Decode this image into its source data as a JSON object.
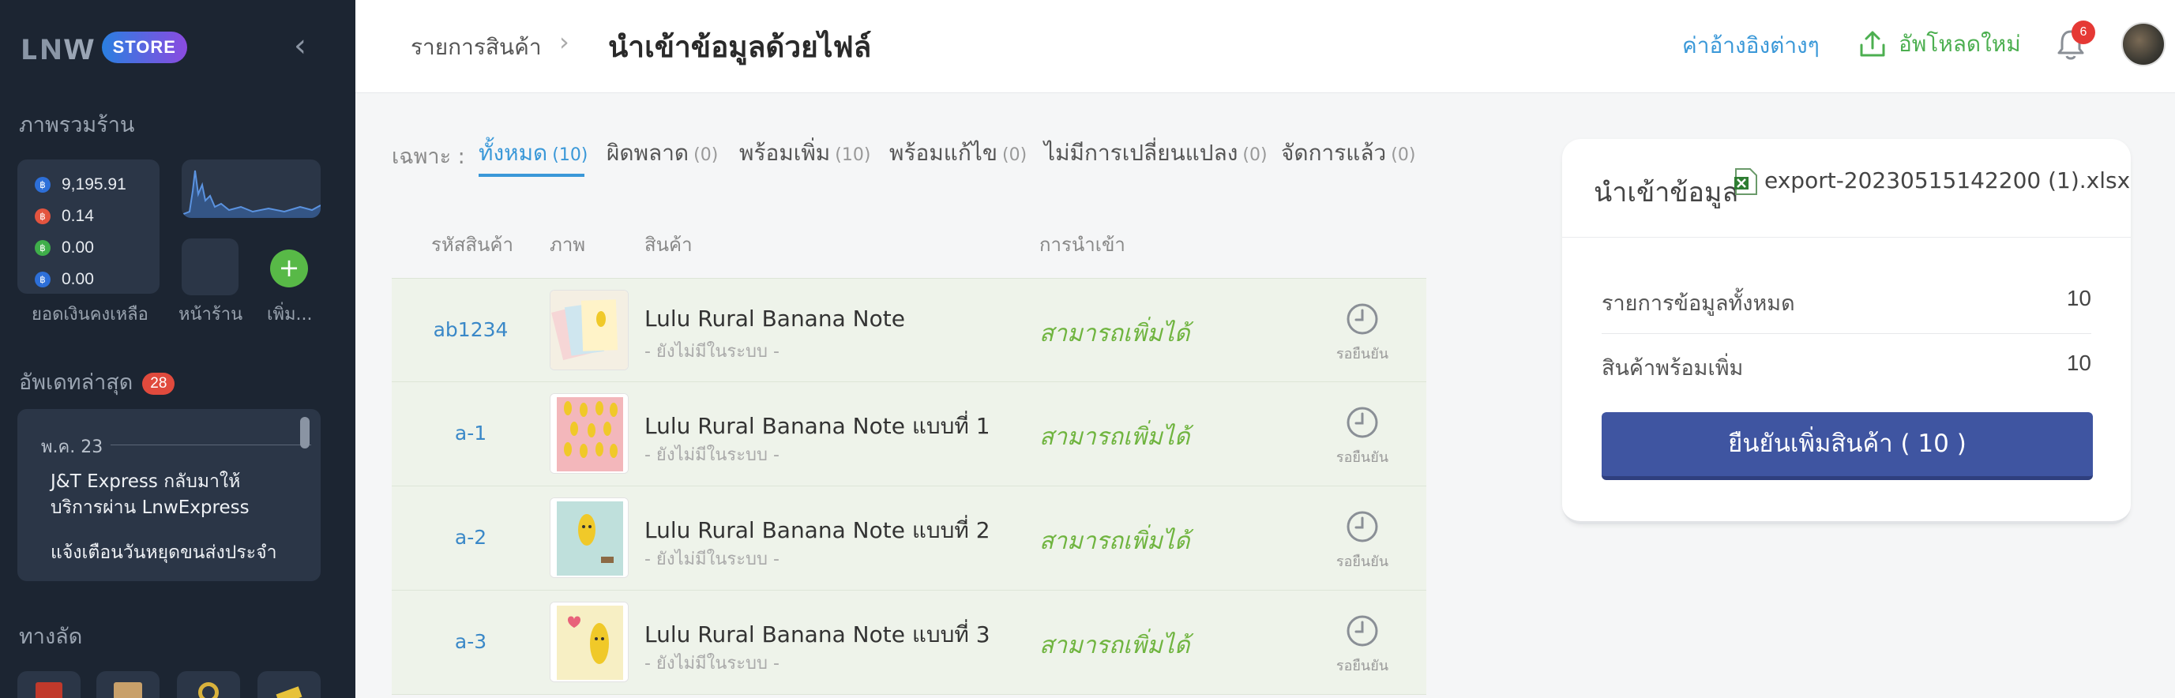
{
  "sidebar": {
    "logo_text": "LNW",
    "logo_badge": "STORE",
    "overview_heading": "ภาพรวมร้าน",
    "balances": [
      {
        "value": "9,195.91",
        "color": "#2d6fd8"
      },
      {
        "value": "0.14",
        "color": "#e3543f"
      },
      {
        "value": "0.00",
        "color": "#3fae4a"
      },
      {
        "value": "0.00",
        "color": "#2d6fd8"
      }
    ],
    "coin_symbol": "฿",
    "balance_caption": "ยอดเงินคงเหลือ",
    "store_caption": "หน้าร้าน",
    "add_caption": "เพิ่ม...",
    "updates_heading": "อัพเดทล่าสุด",
    "updates_count": "28",
    "news_date": "พ.ค. 23",
    "news": [
      "J&T Express กลับมาให้บริการผ่าน LnwExpress",
      "แจ้งเตือนวันหยุดขนส่งประจำ"
    ],
    "shortcuts_heading": "ทางลัด"
  },
  "header": {
    "breadcrumb": "รายการสินค้า",
    "title": "นำเข้าข้อมูลด้วยไฟล์",
    "reference_link": "ค่าอ้างอิงต่างๆ",
    "upload_link": "อัพโหลดใหม่",
    "notification_count": "6"
  },
  "filters": {
    "label": "เฉพาะ :",
    "tabs": [
      {
        "label": "ทั้งหมด",
        "count": "(10)",
        "active": true
      },
      {
        "label": "ผิดพลาด",
        "count": "(0)"
      },
      {
        "label": "พร้อมเพิ่ม",
        "count": "(10)"
      },
      {
        "label": "พร้อมแก้ไข",
        "count": "(0)"
      },
      {
        "label": "ไม่มีการเปลี่ยนแปลง",
        "count": "(0)"
      },
      {
        "label": "จัดการแล้ว",
        "count": "(0)"
      }
    ]
  },
  "table": {
    "columns": [
      "รหัสสินค้า",
      "ภาพ",
      "สินค้า",
      "การนำเข้า"
    ],
    "rows": [
      {
        "sku": "ab1234",
        "name": "Lulu Rural Banana Note",
        "status": "- ยังไม่มีในระบบ -",
        "import": "สามารถเพิ่มได้",
        "state": "รอยืนยัน"
      },
      {
        "sku": "a-1",
        "name": "Lulu Rural Banana Note แบบที่ 1",
        "status": "- ยังไม่มีในระบบ -",
        "import": "สามารถเพิ่มได้",
        "state": "รอยืนยัน"
      },
      {
        "sku": "a-2",
        "name": "Lulu Rural Banana Note แบบที่ 2",
        "status": "- ยังไม่มีในระบบ -",
        "import": "สามารถเพิ่มได้",
        "state": "รอยืนยัน"
      },
      {
        "sku": "a-3",
        "name": "Lulu Rural Banana Note แบบที่ 3",
        "status": "- ยังไม่มีในระบบ -",
        "import": "สามารถเพิ่มได้",
        "state": "รอยืนยัน"
      }
    ]
  },
  "import_panel": {
    "title": "นำเข้าข้อมูล",
    "file_name": "export-20230515142200 (1).xlsx",
    "total_label": "รายการข้อมูลทั้งหมด",
    "total_value": "10",
    "ready_label": "สินค้าพร้อมเพิ่ม",
    "ready_value": "10",
    "confirm_button": "ยืนยันเพิ่มสินค้า ( 10 )"
  },
  "colors": {
    "accent_blue": "#3a98d8",
    "success_green": "#6fb43f",
    "confirm_button": "#3f55a1",
    "sidebar_bg": "#1c2532"
  }
}
